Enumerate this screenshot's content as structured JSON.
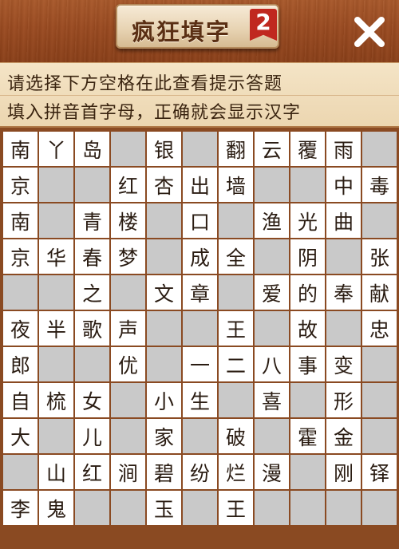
{
  "header": {
    "title": "疯狂填字",
    "badge": "2",
    "close_icon": "close-x-icon"
  },
  "hints": {
    "line1": "请选择下方空格在此查看提示答题",
    "line2": "填入拼音首字母，正确就会显示汉字"
  },
  "colors": {
    "wood": "#9a4a20",
    "panel": "#f0dcb8",
    "empty_cell": "#c9c9c9",
    "filled_cell": "#ffffff",
    "badge": "#c0281f"
  },
  "grid": {
    "rows": [
      [
        "南",
        "丫",
        "岛",
        "",
        "银",
        "",
        "翻",
        "云",
        "覆",
        "雨",
        ""
      ],
      [
        "京",
        "",
        "",
        "红",
        "杏",
        "出",
        "墙",
        "",
        "",
        "中",
        "毒"
      ],
      [
        "南",
        "",
        "青",
        "楼",
        "",
        "口",
        "",
        "渔",
        "光",
        "曲",
        ""
      ],
      [
        "京",
        "华",
        "春",
        "梦",
        "",
        "成",
        "全",
        "",
        "阴",
        "",
        "张"
      ],
      [
        "",
        "",
        "之",
        "",
        "文",
        "章",
        "",
        "爱",
        "的",
        "奉",
        "献"
      ],
      [
        "夜",
        "半",
        "歌",
        "声",
        "",
        "",
        "王",
        "",
        "故",
        "",
        "忠"
      ],
      [
        "郎",
        "",
        "",
        "优",
        "",
        "一",
        "二",
        "八",
        "事",
        "变",
        ""
      ],
      [
        "自",
        "梳",
        "女",
        "",
        "小",
        "生",
        "",
        "喜",
        "",
        "形",
        ""
      ],
      [
        "大",
        "",
        "儿",
        "",
        "家",
        "",
        "破",
        "",
        "霍",
        "金",
        ""
      ],
      [
        "",
        "山",
        "红",
        "涧",
        "碧",
        "纷",
        "烂",
        "漫",
        "",
        "刚",
        "铎"
      ],
      [
        "李",
        "鬼",
        "",
        "",
        "玉",
        "",
        "王",
        "",
        "",
        "",
        ""
      ]
    ]
  }
}
